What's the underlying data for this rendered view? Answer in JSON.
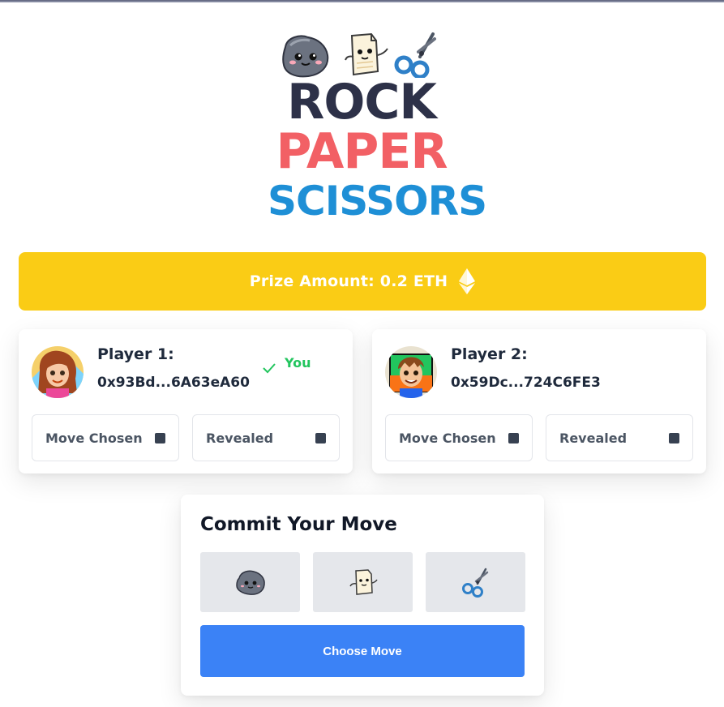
{
  "logo": {
    "word1": "ROCK",
    "word2": "PAPER",
    "word3": "SCISSORS",
    "icons": [
      "rock-mascot-icon",
      "paper-mascot-icon",
      "scissors-mascot-icon"
    ]
  },
  "prize": {
    "label": "Prize Amount: 0.2 ETH",
    "icon": "ethereum-icon",
    "color": "#facc15"
  },
  "players": [
    {
      "label": "Player 1:",
      "address": "0x93Bd...6A63eA60",
      "is_you": true,
      "you_label": "You",
      "move_chosen_label": "Move Chosen",
      "revealed_label": "Revealed"
    },
    {
      "label": "Player 2:",
      "address": "0x59Dc...724C6FE3",
      "is_you": false,
      "move_chosen_label": "Move Chosen",
      "revealed_label": "Revealed"
    }
  ],
  "commit": {
    "title": "Commit Your Move",
    "moves": [
      "rock-icon",
      "paper-icon",
      "scissors-icon"
    ],
    "button_label": "Choose Move",
    "button_color": "#3b82f6"
  },
  "colors": {
    "accent_green": "#22c55e",
    "rock_text": "#2d3148",
    "paper_text": "#f26065",
    "scissors_text": "#1e8fd6"
  }
}
